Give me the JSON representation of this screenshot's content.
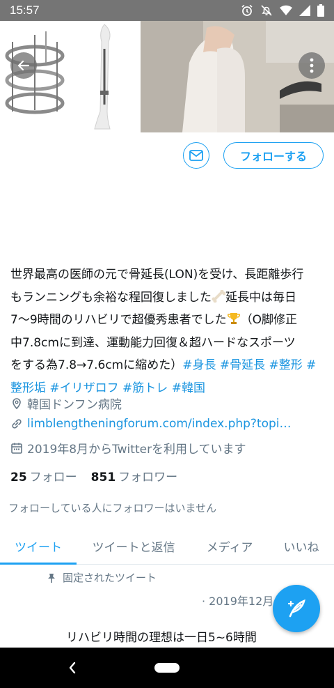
{
  "status_bar": {
    "time": "15:57",
    "icons": [
      "alarm-icon",
      "notifications-off-icon",
      "wifi-icon",
      "signal-icon",
      "battery-icon"
    ]
  },
  "header": {
    "back_icon": "arrow-left-icon",
    "more_icon": "more-vertical-icon"
  },
  "actions": {
    "message_icon": "mail-icon",
    "follow_label": "フォローする"
  },
  "bio": {
    "line1": "世界最高の医師の元で骨延長(LON)を受け、長距離歩行",
    "line2a": "もランニングも余裕な程回復しました",
    "line2b": "延長中は毎日",
    "line3a": "7〜9時間のリハビリで超優秀患者でした",
    "line3b": "（O脚修正",
    "line4": "中7.8cmに到達、運動能力回復＆超ハードなスポーツ",
    "line5_text": "をする為7.8→7.6cmに縮めた）",
    "line5_tags": "#身長 #骨延長 #整形 #",
    "line6_tags": "整形垢 #イリザロフ #筋トレ #韓国"
  },
  "profile_meta": {
    "location": "韓国ドンフン病院",
    "link": "limblengtheningforum.com/index.php?topi…",
    "joined": "2019年8月からTwitterを利用しています"
  },
  "counts": {
    "following_count": "25",
    "following_label": "フォロー",
    "followers_count": "851",
    "followers_label": "フォロワー"
  },
  "followers_you_know": "フォローしている人にフォロワーはいません",
  "tabs": [
    {
      "label": "ツイート",
      "active": true
    },
    {
      "label": "ツイートと返信",
      "active": false
    },
    {
      "label": "メディア",
      "active": false
    },
    {
      "label": "いいね",
      "active": false
    }
  ],
  "pinned": {
    "label": "固定されたツイート",
    "date": "· 2019年12月",
    "text": "リハビリ時間の理想は一日5~6時間"
  },
  "colors": {
    "accent": "#1da1f2",
    "link": "#1b95e0",
    "secondary_text": "#657786"
  }
}
